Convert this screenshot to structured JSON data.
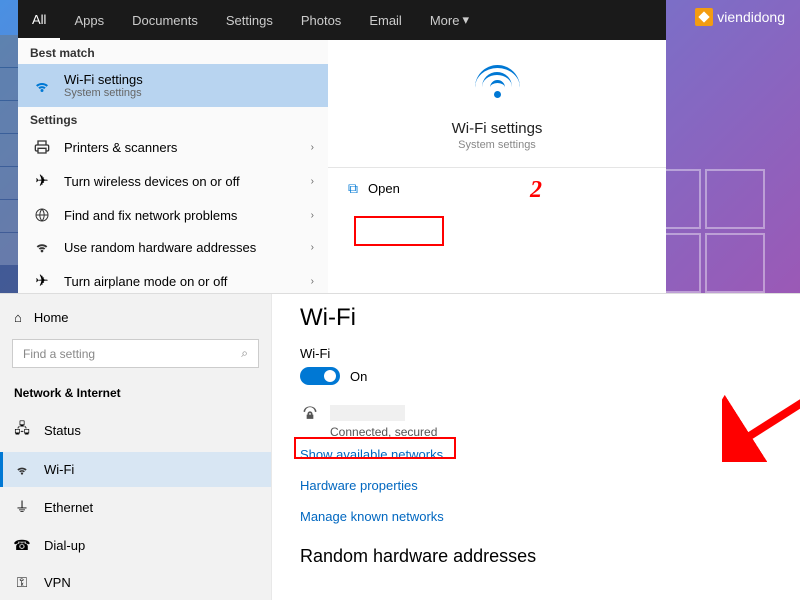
{
  "tabs": [
    "All",
    "Apps",
    "Documents",
    "Settings",
    "Photos",
    "Email",
    "More"
  ],
  "watermark": "viendidong",
  "search": {
    "best_match_label": "Best match",
    "best_match": {
      "title": "Wi-Fi settings",
      "subtitle": "System settings"
    },
    "settings_label": "Settings",
    "settings_items": [
      "Printers & scanners",
      "Turn wireless devices on or off",
      "Find and fix network problems",
      "Use random hardware addresses",
      "Turn airplane mode on or off"
    ],
    "detail": {
      "title": "Wi-Fi settings",
      "subtitle": "System settings",
      "open": "Open"
    }
  },
  "annotation_number": "2",
  "settings": {
    "home": "Home",
    "search_placeholder": "Find a setting",
    "category": "Network & Internet",
    "nav": [
      "Status",
      "Wi-Fi",
      "Ethernet",
      "Dial-up",
      "VPN"
    ],
    "page_title": "Wi-Fi",
    "wifi_label": "Wi-Fi",
    "toggle_state": "On",
    "network_status": "Connected, secured",
    "links": {
      "show": "Show available networks",
      "hw": "Hardware properties",
      "manage": "Manage known networks"
    },
    "random_h": "Random hardware addresses"
  }
}
